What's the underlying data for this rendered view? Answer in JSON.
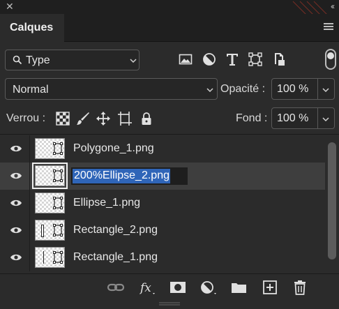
{
  "panel": {
    "tab_label": "Calques"
  },
  "filter": {
    "kind_label": "Type",
    "icons": [
      "image-filter-icon",
      "adjustment-filter-icon",
      "type-filter-icon",
      "shape-filter-icon",
      "smart-object-filter-icon"
    ]
  },
  "blend": {
    "mode": "Normal",
    "opacity_label": "Opacité :",
    "opacity_value": "100 %"
  },
  "lock": {
    "label": "Verrou :",
    "fill_label": "Fond :",
    "fill_value": "100 %"
  },
  "layers": [
    {
      "name": "Polygone_1.png",
      "selected": false
    },
    {
      "name": "200%Ellipse_2.png",
      "selected": true,
      "editing": true
    },
    {
      "name": "Ellipse_1.png",
      "selected": false
    },
    {
      "name": "Rectangle_2.png",
      "selected": false
    },
    {
      "name": "Rectangle_1.png",
      "selected": false
    }
  ],
  "colors": {
    "panel_bg": "#2b2b2b",
    "selected_row": "#3e3e3e",
    "text_highlight": "#2f65b8"
  }
}
